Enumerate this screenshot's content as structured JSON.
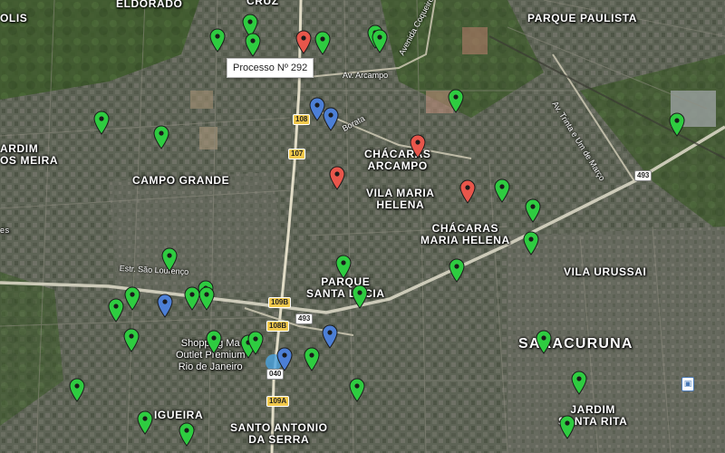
{
  "map": {
    "tooltip": "Processo Nº 292",
    "colors": {
      "green": "#2ecc40",
      "red": "#e8564b",
      "blue": "#4c7fd6",
      "shield_yellow": "#f2c94c",
      "shield_white": "#ffffff"
    },
    "labels": {
      "eldorado": "ELDORADO",
      "cruz": "CRUZ",
      "parque_paulista": "PARQUE PAULISTA",
      "olis": "OLIS",
      "jardim_meira_1": "ARDIM",
      "jardim_meira_2": "OS MEIRA",
      "campo_grande": "CAMPO GRANDE",
      "chacaras_arcampo_1": "CHÁCARAS",
      "chacaras_arcampo_2": "ARCAMPO",
      "vila_maria_helena_1": "VILA MARIA",
      "vila_maria_helena_2": "HELENA",
      "chacaras_mh_1": "CHÁCARAS",
      "chacaras_mh_2": "MARIA HELENA",
      "parque_santa_lucia_1": "PARQUE",
      "parque_santa_lucia_2": "SANTA LUCIA",
      "vila_urussai": "VILA URUSSAI",
      "saracuruna": "SARACURUNA",
      "shopping_1": "Shopping Ma",
      "shopping_2": "Outlet Premium",
      "shopping_3": "Rio de Janeiro",
      "figueira": "IGUEIRA",
      "santo_antonio_1": "SANTO ANTONIO",
      "santo_antonio_2": "DA SERRA",
      "jardim_santa_rita_1": "JARDIM",
      "jardim_santa_rita_2": "SANTA RITA",
      "es_left": "es"
    },
    "streets": {
      "av_arcampo": "Av. Arcampo",
      "av_coqueiros": "Avenida Coqueiros",
      "borata": "Borata",
      "estr_sao_lourenco": "Estr. São Lourenço",
      "av_trinta_um_marco": "Av. Trinta e Um de Março"
    },
    "shields": {
      "s108": "108",
      "s107": "107",
      "s109b": "109B",
      "s108b": "108B",
      "s493a": "493",
      "s493b": "493",
      "s040": "040",
      "s109a": "109A"
    },
    "markers": [
      {
        "color": "green"
      },
      {
        "color": "green"
      },
      {
        "color": "green"
      },
      {
        "color": "red"
      },
      {
        "color": "green"
      },
      {
        "color": "green"
      },
      {
        "color": "green"
      },
      {
        "color": "blue"
      },
      {
        "color": "blue"
      },
      {
        "color": "green"
      },
      {
        "color": "green"
      },
      {
        "color": "red"
      },
      {
        "color": "red"
      },
      {
        "color": "green"
      },
      {
        "color": "green"
      },
      {
        "color": "red"
      },
      {
        "color": "green"
      },
      {
        "color": "green"
      },
      {
        "color": "green"
      },
      {
        "color": "green"
      },
      {
        "color": "green"
      },
      {
        "color": "green"
      },
      {
        "color": "green"
      },
      {
        "color": "green"
      },
      {
        "color": "blue"
      },
      {
        "color": "green"
      },
      {
        "color": "green"
      },
      {
        "color": "green"
      },
      {
        "color": "green"
      },
      {
        "color": "green"
      },
      {
        "color": "blue"
      },
      {
        "color": "blue"
      },
      {
        "color": "green"
      },
      {
        "color": "green"
      },
      {
        "color": "green"
      },
      {
        "color": "green"
      },
      {
        "color": "green"
      },
      {
        "color": "green"
      },
      {
        "color": "green"
      },
      {
        "color": "green"
      },
      {
        "color": "green"
      },
      {
        "color": "green"
      },
      {
        "color": "green"
      }
    ]
  }
}
